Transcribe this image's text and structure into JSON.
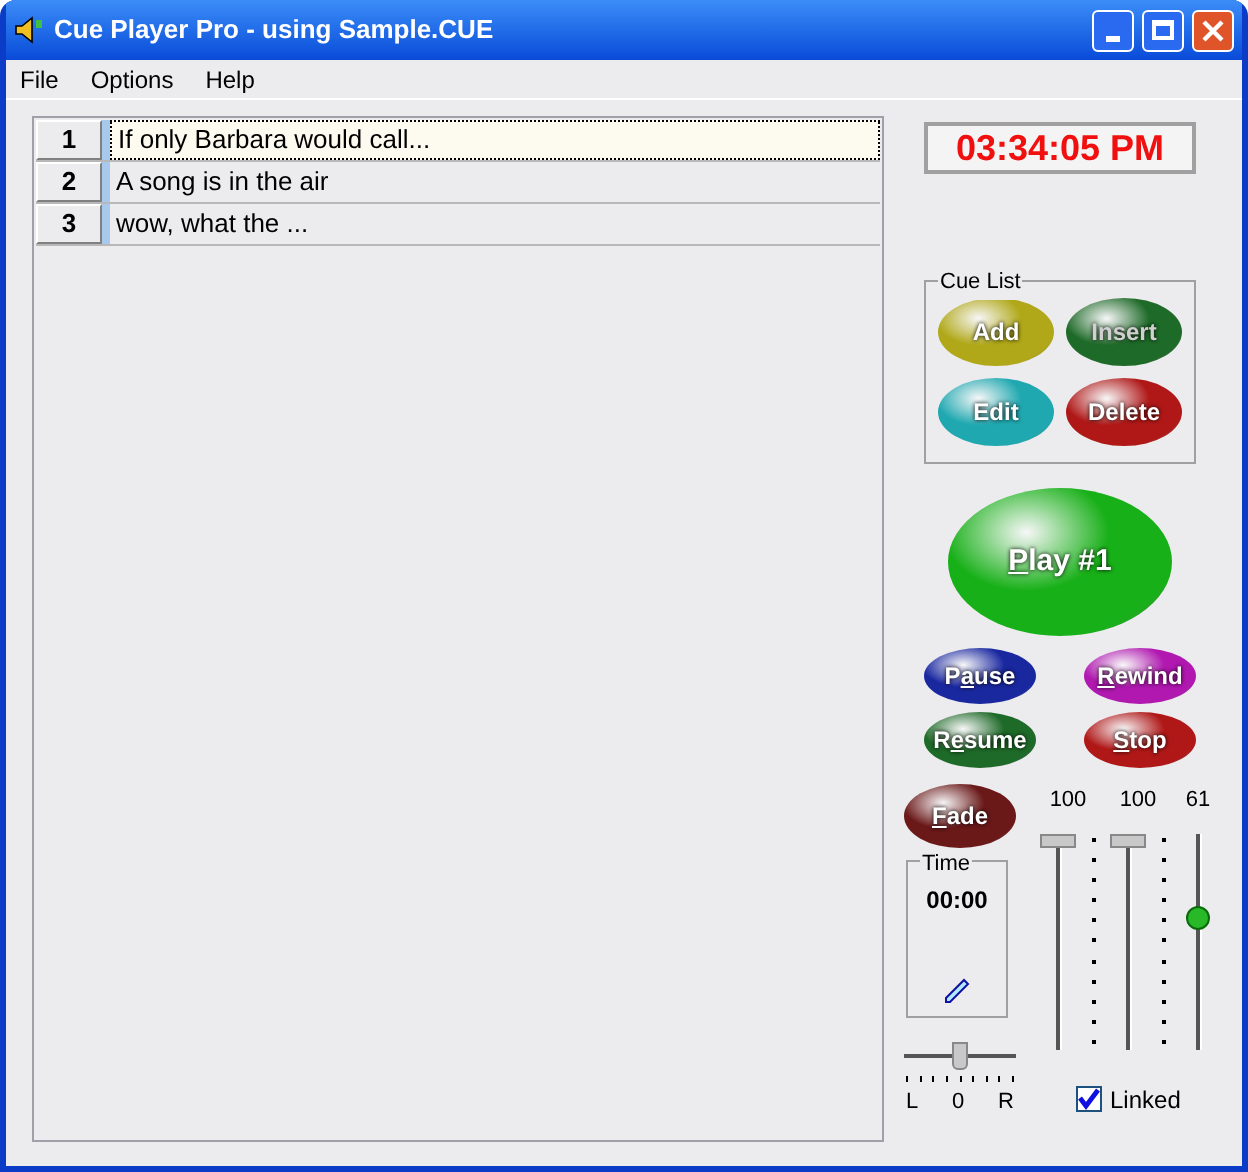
{
  "window": {
    "title": "Cue Player Pro - using Sample.CUE"
  },
  "menu": [
    "File",
    "Options",
    "Help"
  ],
  "cues": [
    {
      "number": "1",
      "title": "If only Barbara would call...",
      "selected": true
    },
    {
      "number": "2",
      "title": "A song is in the air",
      "selected": false
    },
    {
      "number": "3",
      "title": "wow, what the ...",
      "selected": false
    }
  ],
  "clock": "03:34:05 PM",
  "cue_list": {
    "title": "Cue List",
    "buttons": [
      {
        "label": {
          "after": "Add"
        },
        "color": "#b0a818",
        "disabled": false
      },
      {
        "label": {
          "after": "Insert"
        },
        "color": "#1e6a28",
        "disabled": true
      },
      {
        "label": {
          "after": "Edit"
        },
        "color": "#20a8b0",
        "disabled": false
      },
      {
        "label": {
          "after": "Delete"
        },
        "color": "#b01818",
        "disabled": false
      }
    ]
  },
  "play": {
    "label": {
      "key": "P",
      "after": "lay #1"
    },
    "color": "#18b018"
  },
  "transport": [
    {
      "label": {
        "before": "P",
        "key": "a",
        "after": "use"
      },
      "color": "#1a28a0"
    },
    {
      "label": {
        "key": "R",
        "after": "ewind"
      },
      "color": "#b018b0"
    },
    {
      "label": {
        "before": "R",
        "key": "e",
        "after": "sume"
      },
      "color": "#1e6a28"
    },
    {
      "label": {
        "key": "S",
        "after": "top"
      },
      "color": "#b01818"
    }
  ],
  "fade": {
    "label": {
      "key": "F",
      "after": "ade"
    },
    "color": "#6a1818"
  },
  "time": {
    "title": "Time",
    "value": "00:00"
  },
  "pan": {
    "level": 0.5,
    "labels": [
      "L",
      "0",
      "R"
    ]
  },
  "volumes": [
    {
      "reading": "100",
      "level": 1
    },
    {
      "reading": "100",
      "level": 1
    },
    {
      "reading": "61",
      "level": 0.61
    }
  ],
  "linked": {
    "label": "Linked",
    "checked": true
  }
}
